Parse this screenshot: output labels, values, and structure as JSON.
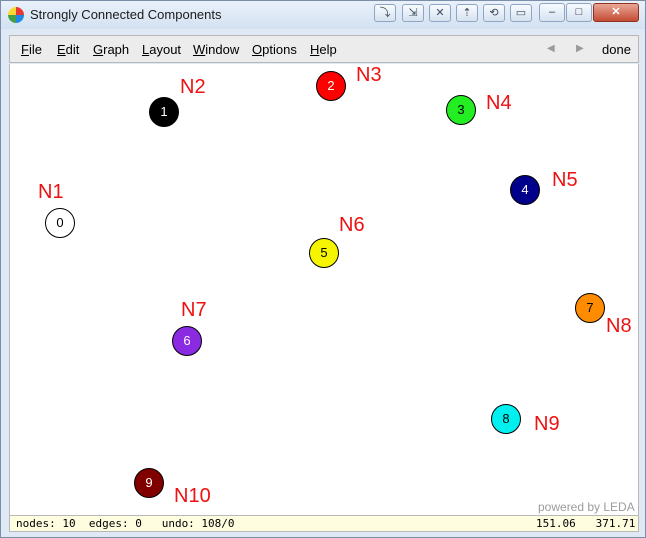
{
  "window": {
    "title": "Strongly Connected Components",
    "title_buttons": [
      "⤵",
      "⇲",
      "✕",
      "⇡",
      "⟲",
      "▭"
    ],
    "min_label": "–",
    "max_label": "□",
    "close_label": "✕"
  },
  "menu": {
    "items": [
      {
        "acc": "F",
        "rest": "ile"
      },
      {
        "acc": "E",
        "rest": "dit"
      },
      {
        "acc": "G",
        "rest": "raph"
      },
      {
        "acc": "L",
        "rest": "ayout"
      },
      {
        "acc": "W",
        "rest": "indow"
      },
      {
        "acc": "O",
        "rest": "ptions"
      },
      {
        "acc": "H",
        "rest": "elp"
      }
    ],
    "prev_icon": "◀",
    "next_icon": "▶",
    "done": "done"
  },
  "graph": {
    "nodes": [
      {
        "index": "0",
        "name": "N1",
        "color": "#ffffff",
        "text_color": "#000000"
      },
      {
        "index": "1",
        "name": "N2",
        "color": "#000000",
        "text_color": "#ffffff"
      },
      {
        "index": "2",
        "name": "N3",
        "color": "#ff0000",
        "text_color": "#ffffff"
      },
      {
        "index": "3",
        "name": "N4",
        "color": "#22ee22",
        "text_color": "#000000"
      },
      {
        "index": "4",
        "name": "N5",
        "color": "#00008b",
        "text_color": "#ffffff"
      },
      {
        "index": "5",
        "name": "N6",
        "color": "#f5f500",
        "text_color": "#000000"
      },
      {
        "index": "6",
        "name": "N7",
        "color": "#8a2be2",
        "text_color": "#ffffff"
      },
      {
        "index": "7",
        "name": "N8",
        "color": "#ff8c00",
        "text_color": "#000000"
      },
      {
        "index": "8",
        "name": "N9",
        "color": "#00f0f0",
        "text_color": "#000000"
      },
      {
        "index": "9",
        "name": "N10",
        "color": "#800000",
        "text_color": "#ffffff"
      }
    ],
    "label_color": "#ee1111"
  },
  "powered_by": "powered by LEDA",
  "status": {
    "left": "nodes: 10  edges: 0   undo: 108/0",
    "x": "151.06",
    "y": "371.71"
  }
}
